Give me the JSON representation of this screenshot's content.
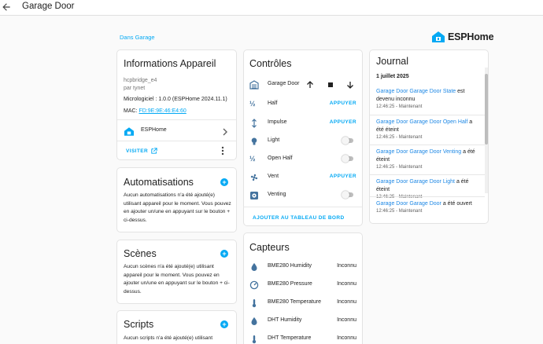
{
  "header": {
    "title": "Garage Door"
  },
  "area_link": "Dans Garage",
  "brand": {
    "name": "ESPHome",
    "color": "#03a9f4"
  },
  "device_info": {
    "title": "Informations Appareil",
    "model": "hcpbridge_e4",
    "manufacturer": "par tynet",
    "firmware": "Micrologiciel : 1.0.0 (ESPHome 2024.11.1)",
    "mac_label": "MAC: ",
    "mac_value": "FD:9E:9E:46:E4:60",
    "integration": "ESPHome",
    "visit_label": "VISITER"
  },
  "automations": {
    "title": "Automatisations",
    "empty": "Aucun automatisations n'a été ajouté(e) utilisant appareil pour le moment. Vous pouvez en ajouter un/une en appuyant sur le bouton + ci-dessus."
  },
  "scenes": {
    "title": "Scènes",
    "empty": "Aucun scènes n'a été ajouté(e) utilisant appareil pour le moment. Vous pouvez en ajouter un/une en appuyant sur le bouton + ci-dessus."
  },
  "scripts": {
    "title": "Scripts",
    "empty": "Aucun scripts n'a été ajouté(e) utilisant"
  },
  "controls": {
    "title": "Contrôles",
    "items": [
      {
        "label": "Garage Door",
        "icon": "garage-icon",
        "type": "cover"
      },
      {
        "label": "Half",
        "icon": "half-icon",
        "type": "button",
        "action": "APPUYER"
      },
      {
        "label": "Impulse",
        "icon": "arrow-vertical-icon",
        "type": "button",
        "action": "APPUYER"
      },
      {
        "label": "Light",
        "icon": "lightbulb-icon",
        "type": "switch",
        "state": "off"
      },
      {
        "label": "Open Half",
        "icon": "half-icon",
        "type": "switch",
        "state": "off"
      },
      {
        "label": "Vent",
        "icon": "fan-icon",
        "type": "button",
        "action": "APPUYER"
      },
      {
        "label": "Venting",
        "icon": "vent-icon",
        "type": "switch",
        "state": "off"
      }
    ],
    "add_to_dashboard": "AJOUTER AU TABLEAU DE BORD"
  },
  "sensors": {
    "title": "Capteurs",
    "items": [
      {
        "label": "BME280 Humidity",
        "value": "Inconnu",
        "icon": "water-drop-icon"
      },
      {
        "label": "BME280 Pressure",
        "value": "Inconnu",
        "icon": "gauge-icon"
      },
      {
        "label": "BME280 Temperature",
        "value": "Inconnu",
        "icon": "thermometer-icon"
      },
      {
        "label": "DHT Humidity",
        "value": "Inconnu",
        "icon": "water-drop-icon"
      },
      {
        "label": "DHT Temperature",
        "value": "Inconnu",
        "icon": "thermometer-icon"
      }
    ]
  },
  "logbook": {
    "title": "Journal",
    "date": "1 juillet 2025",
    "entries": [
      {
        "entity": "Garage Door Garage Door State",
        "message": " est devenu inconnu",
        "time": "12:46:25 - Maintenant"
      },
      {
        "entity": "Garage Door Garage Door Open Half",
        "message": " a été éteint",
        "time": "12:46:25 - Maintenant"
      },
      {
        "entity": "Garage Door Garage Door Venting",
        "message": " a été éteint",
        "time": "12:46:25 - Maintenant"
      },
      {
        "entity": "Garage Door Garage Door Light",
        "message": " a été éteint",
        "time": "12:46:25 - Maintenant"
      },
      {
        "entity": "Garage Door Garage Door",
        "message": " a été ouvert",
        "time": "12:46:25 - Maintenant"
      }
    ]
  }
}
